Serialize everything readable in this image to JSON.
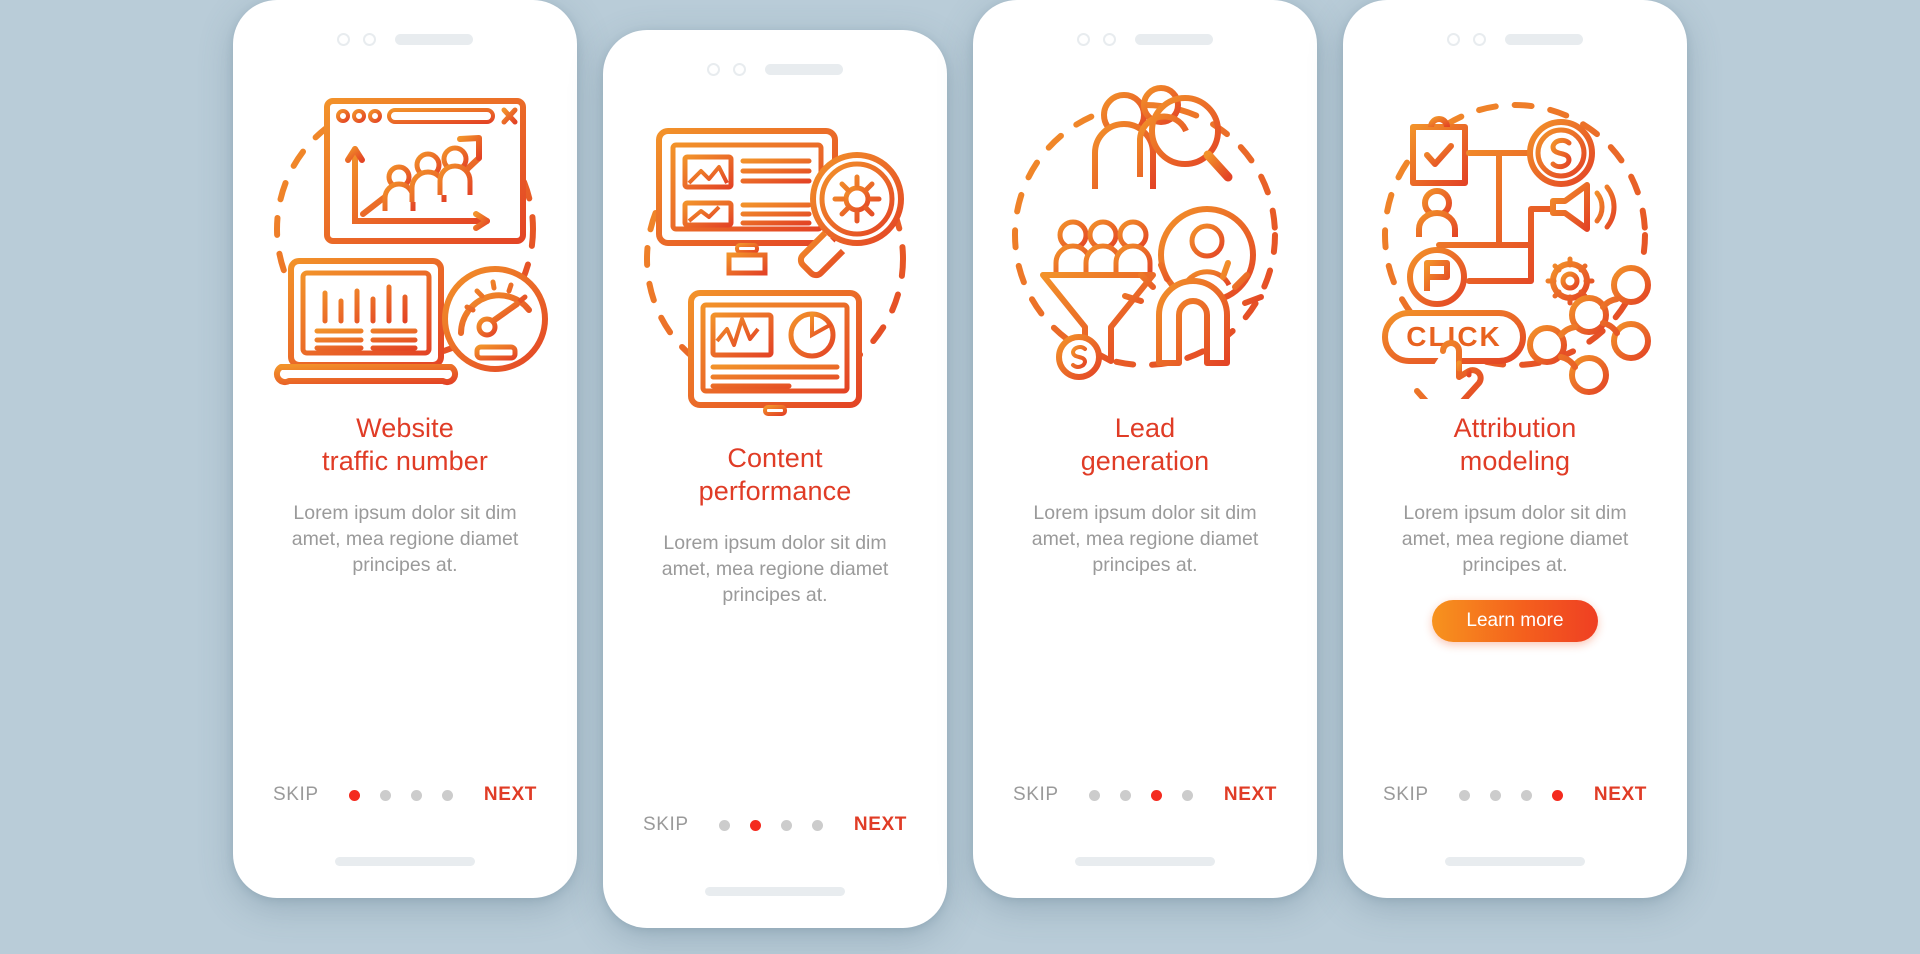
{
  "background_color": "#b9ccd8",
  "theme": {
    "title_color": "#e03c26",
    "desc_color": "#9a9a9a",
    "next_color": "#e03c26",
    "skip_color": "#9a9a9a",
    "active_dot_color": "#f42a1e",
    "inactive_dot_color": "#cccccc",
    "gradient_start": "#f7931e",
    "gradient_end": "#ef3f23"
  },
  "common": {
    "skip_label": "SKIP",
    "next_label": "NEXT",
    "description": "Lorem ipsum dolor sit dim amet, mea regione diamet principes at.",
    "total_steps": 4
  },
  "screens": [
    {
      "index": 1,
      "title_line1": "Website",
      "title_line2": "traffic number",
      "description": "Lorem ipsum dolor sit dim amet, mea regione diamet principes at.",
      "skip_label": "SKIP",
      "next_label": "NEXT",
      "active_dot": 1,
      "has_learn_more": false,
      "illustration": "website-traffic-illustration",
      "illustration_elements": [
        "browser-window-icon",
        "growth-chart-icon",
        "people-group-icon",
        "laptop-chart-icon",
        "speedometer-icon",
        "dashed-circle"
      ]
    },
    {
      "index": 2,
      "title_line1": "Content",
      "title_line2": "performance",
      "description": "Lorem ipsum dolor sit dim amet, mea regione diamet principes at.",
      "skip_label": "SKIP",
      "next_label": "NEXT",
      "active_dot": 2,
      "has_learn_more": false,
      "illustration": "content-performance-illustration",
      "illustration_elements": [
        "monitor-article-icon",
        "magnifier-gear-icon",
        "monitor-analytics-icon",
        "pie-chart-icon",
        "dashed-circle"
      ]
    },
    {
      "index": 3,
      "title_line1": "Lead",
      "title_line2": "generation",
      "description": "Lorem ipsum dolor sit dim amet, mea regione diamet principes at.",
      "skip_label": "SKIP",
      "next_label": "NEXT",
      "active_dot": 3,
      "has_learn_more": false,
      "illustration": "lead-generation-illustration",
      "illustration_elements": [
        "people-search-icon",
        "sales-funnel-icon",
        "dollar-coin-icon",
        "magnet-icon",
        "user-avatar-icon",
        "dashed-circle"
      ]
    },
    {
      "index": 4,
      "title_line1": "Attribution",
      "title_line2": "modeling",
      "description": "Lorem ipsum dolor sit dim amet, mea regione diamet principes at.",
      "skip_label": "SKIP",
      "next_label": "NEXT",
      "active_dot": 4,
      "has_learn_more": true,
      "learn_more_label": "Learn more",
      "illustration": "attribution-modeling-illustration",
      "illustration_elements": [
        "clipboard-check-icon",
        "user-icon",
        "flag-circle-icon",
        "dollar-circle-icon",
        "megaphone-icon",
        "gear-icon",
        "click-button-icon",
        "pointer-hand-icon",
        "node-tree-icon",
        "dashed-circle"
      ],
      "click_button_label": "CLICK"
    }
  ]
}
